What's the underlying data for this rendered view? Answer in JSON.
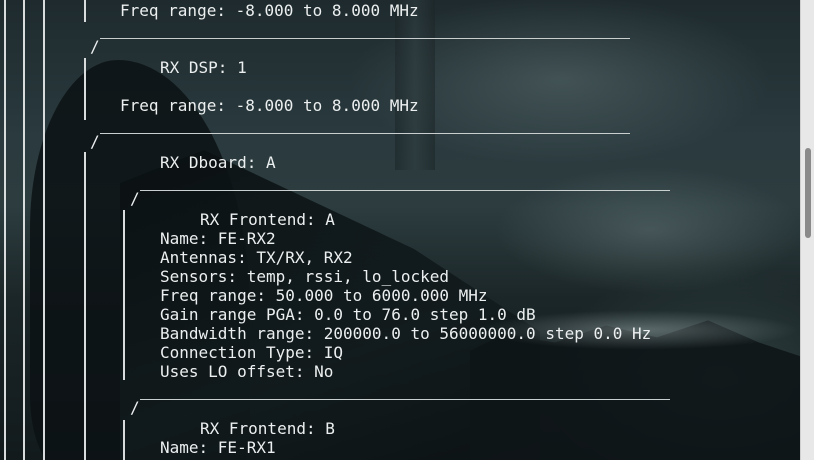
{
  "window": {
    "background_accent": "#2c3c3f",
    "text_color": "#ecefef"
  },
  "lines": [
    "Freq range: -8.000 to 8.000 MHz",
    "RX DSP: 1",
    "Freq range: -8.000 to 8.000 MHz",
    "RX Dboard: A",
    "RX Frontend: A",
    "Name: FE-RX2",
    "Antennas: TX/RX, RX2",
    "Sensors: temp, rssi, lo_locked",
    "Freq range: 50.000 to 6000.000 MHz",
    "Gain range PGA: 0.0 to 76.0 step 1.0 dB",
    "Bandwidth range: 200000.0 to 56000000.0 step 0.0 Hz",
    "Connection Type: IQ",
    "Uses LO offset: No",
    "RX Frontend: B",
    "Name: FE-RX1"
  ],
  "tree_glyphs": {
    "slash": "/"
  },
  "scrollbar": {
    "icon": "scrollbar-thumb"
  }
}
